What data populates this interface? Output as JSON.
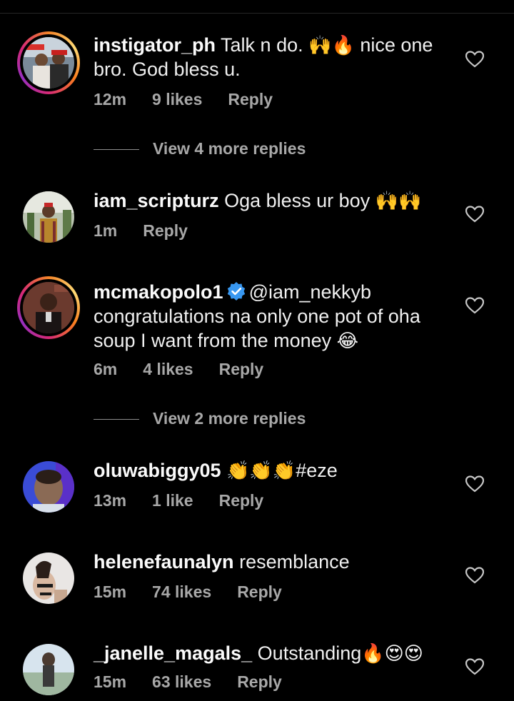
{
  "comments": [
    {
      "username": "instigator_ph",
      "text_line1": "Talk n do. ",
      "emoji1": "🙌🔥",
      "text_line1b": " nice one",
      "text_line2": "bro. God bless u.",
      "time": "12m",
      "likes": "9 likes",
      "reply": "Reply"
    },
    {
      "username": "iam_scripturz",
      "text": "Oga bless ur boy ",
      "emoji": "🙌🙌",
      "time": "1m",
      "reply": "Reply"
    },
    {
      "username": "mcmakopolo1",
      "mention": "@iam_nekkyb",
      "text_line2": "congratulations na only one pot of oha",
      "text_line3": "soup I want from the money ",
      "emoji": "😂",
      "time": "6m",
      "likes": "4 likes",
      "reply": "Reply"
    },
    {
      "username": "oluwabiggy05",
      "emoji": "👏👏👏",
      "text": "#eze",
      "time": "13m",
      "likes": "1 like",
      "reply": "Reply"
    },
    {
      "username": "helenefaunalyn",
      "text": "resemblance",
      "time": "15m",
      "likes": "74 likes",
      "reply": "Reply"
    },
    {
      "username": "_janelle_magals_",
      "text": "Outstanding",
      "emoji": "🔥😍😍",
      "time": "15m",
      "likes": "63 likes",
      "reply": "Reply"
    }
  ],
  "view_replies": [
    {
      "label": "View 4 more replies"
    },
    {
      "label": "View 2 more replies"
    }
  ],
  "colors": {
    "background": "#000000",
    "meta_text": "#a8a8a8",
    "verified": "#3897f0"
  }
}
